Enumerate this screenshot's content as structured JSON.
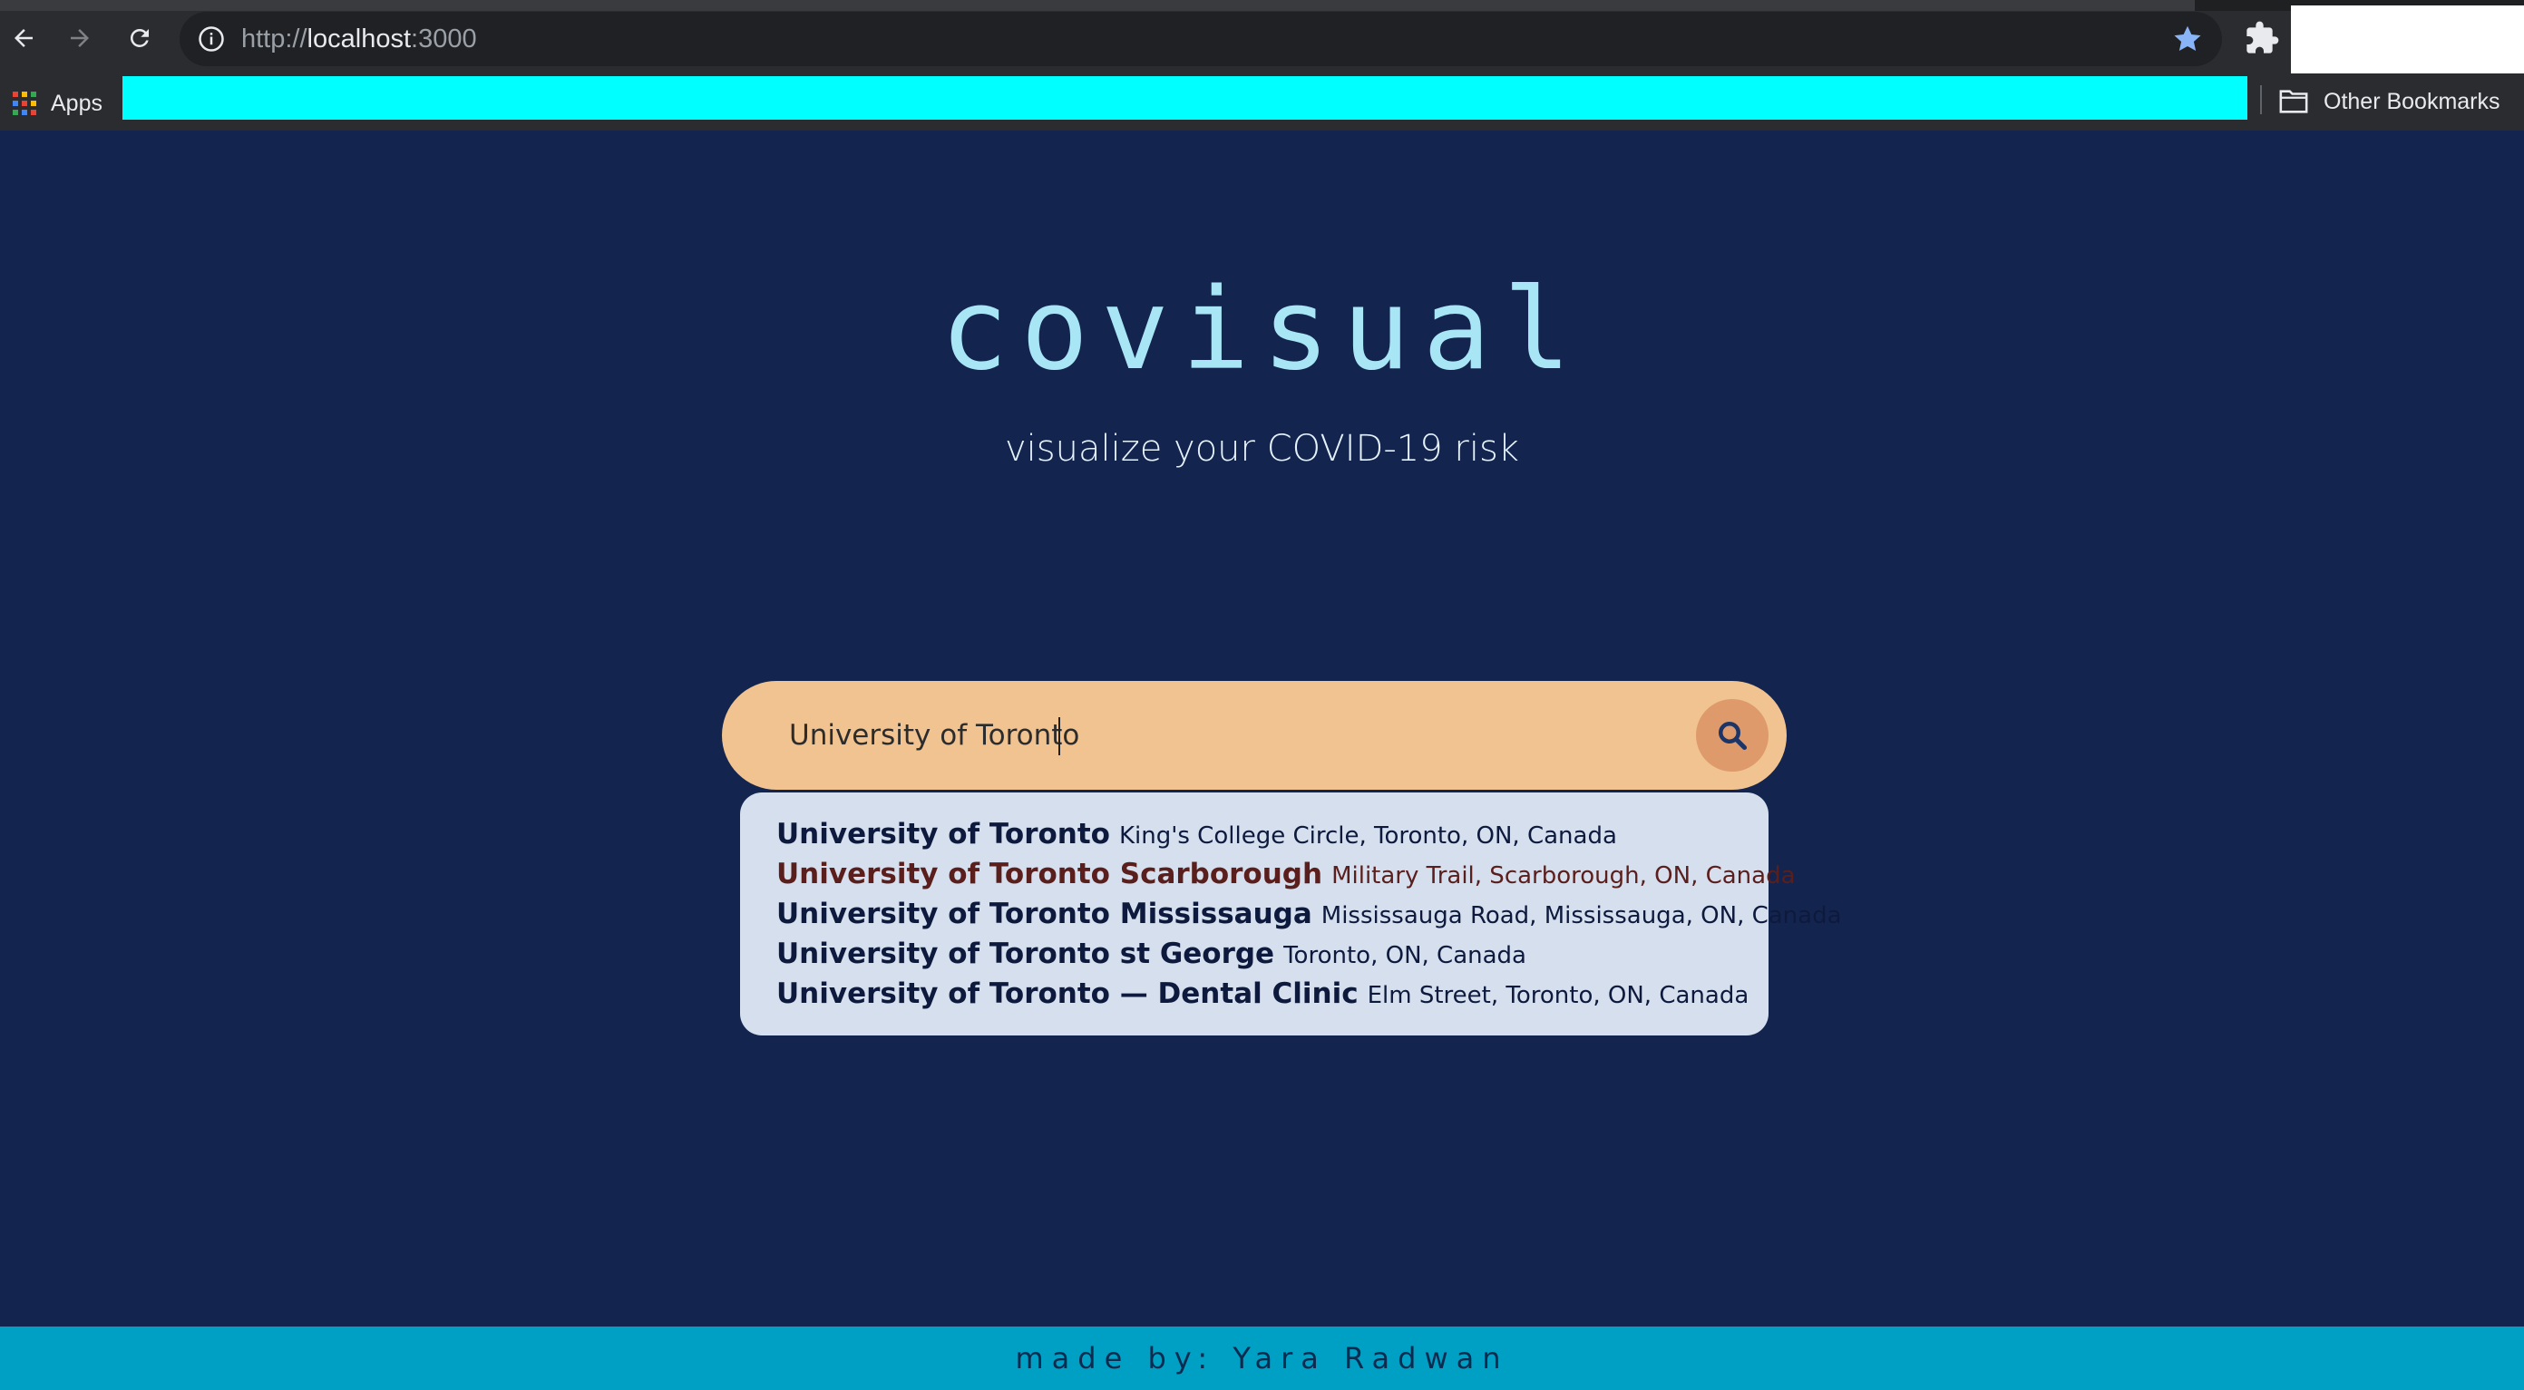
{
  "browser": {
    "url_scheme": "http://",
    "url_host": "localhost",
    "url_port": ":3000",
    "apps_label": "Apps",
    "other_bookmarks_label": "Other Bookmarks"
  },
  "page": {
    "logo": "covisual",
    "tagline": "visualize your COVID-19 risk"
  },
  "search": {
    "value": "University of Toronto",
    "placeholder": ""
  },
  "suggestions": [
    {
      "main": "University of Toronto",
      "sub": "King's College Circle, Toronto, ON, Canada"
    },
    {
      "main": "University of Toronto Scarborough",
      "sub": "Military Trail, Scarborough, ON, Canada"
    },
    {
      "main": "University of Toronto Mississauga",
      "sub": "Mississauga Road, Mississauga, ON, Canada"
    },
    {
      "main": "University of Toronto st George",
      "sub": "Toronto, ON, Canada"
    },
    {
      "main": "University of Toronto — Dental Clinic",
      "sub": "Elm Street, Toronto, ON, Canada"
    }
  ],
  "footer": {
    "text": "made by: Yara Radwan"
  },
  "colors": {
    "background": "#13254f",
    "logo": "#a9e6f5",
    "search_bar": "#f0c391",
    "search_button": "#de9a6a",
    "dropdown": "#d5dfee",
    "footer": "#009fc4",
    "bookmark_highlight": "#00ffff"
  },
  "icons": {
    "back": "back-arrow-icon",
    "forward": "forward-arrow-icon",
    "reload": "reload-icon",
    "site_info": "info-icon",
    "bookmark_star": "star-icon",
    "extensions": "puzzle-icon",
    "apps": "apps-grid-icon",
    "folder": "folder-icon",
    "search": "search-icon"
  }
}
